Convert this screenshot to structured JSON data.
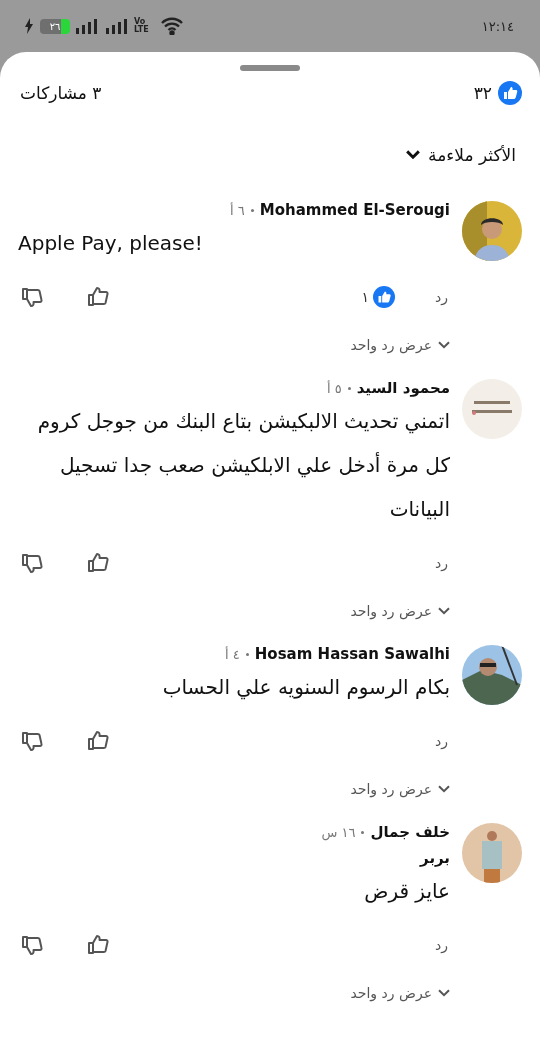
{
  "status_bar": {
    "time": "١٢:١٤",
    "battery": "٢٦",
    "network": "Vo LTE"
  },
  "header": {
    "likes": "٣٢",
    "shares": "٣ مشاركات"
  },
  "sort": {
    "label": "الأكثر ملاءمة"
  },
  "comments": [
    {
      "author": "Mohammed El-Serougi",
      "time": "٦ أ",
      "text": "Apple Pay, please!",
      "reactions": "١",
      "reply": "رد",
      "view_replies": "عرض رد واحد"
    },
    {
      "author": "محمود السيد",
      "time": "٥ أ",
      "text": "اتمني تحديث الالبكيشن بتاع البنك من جوجل كروم كل مرة أدخل علي الابلكيشن صعب جدا تسجيل البيانات",
      "reply": "رد",
      "view_replies": "عرض رد واحد"
    },
    {
      "author": "Hosam Hassan Sawalhi",
      "time": "٤ أ",
      "text": "بكام الرسوم السنويه علي الحساب",
      "reply": "رد",
      "view_replies": "عرض رد واحد"
    },
    {
      "author": "خلف جمال",
      "subtitle": "بربر",
      "time": "١٦ س",
      "text": "عايز قرض",
      "reply": "رد",
      "view_replies": "عرض رد واحد"
    }
  ]
}
